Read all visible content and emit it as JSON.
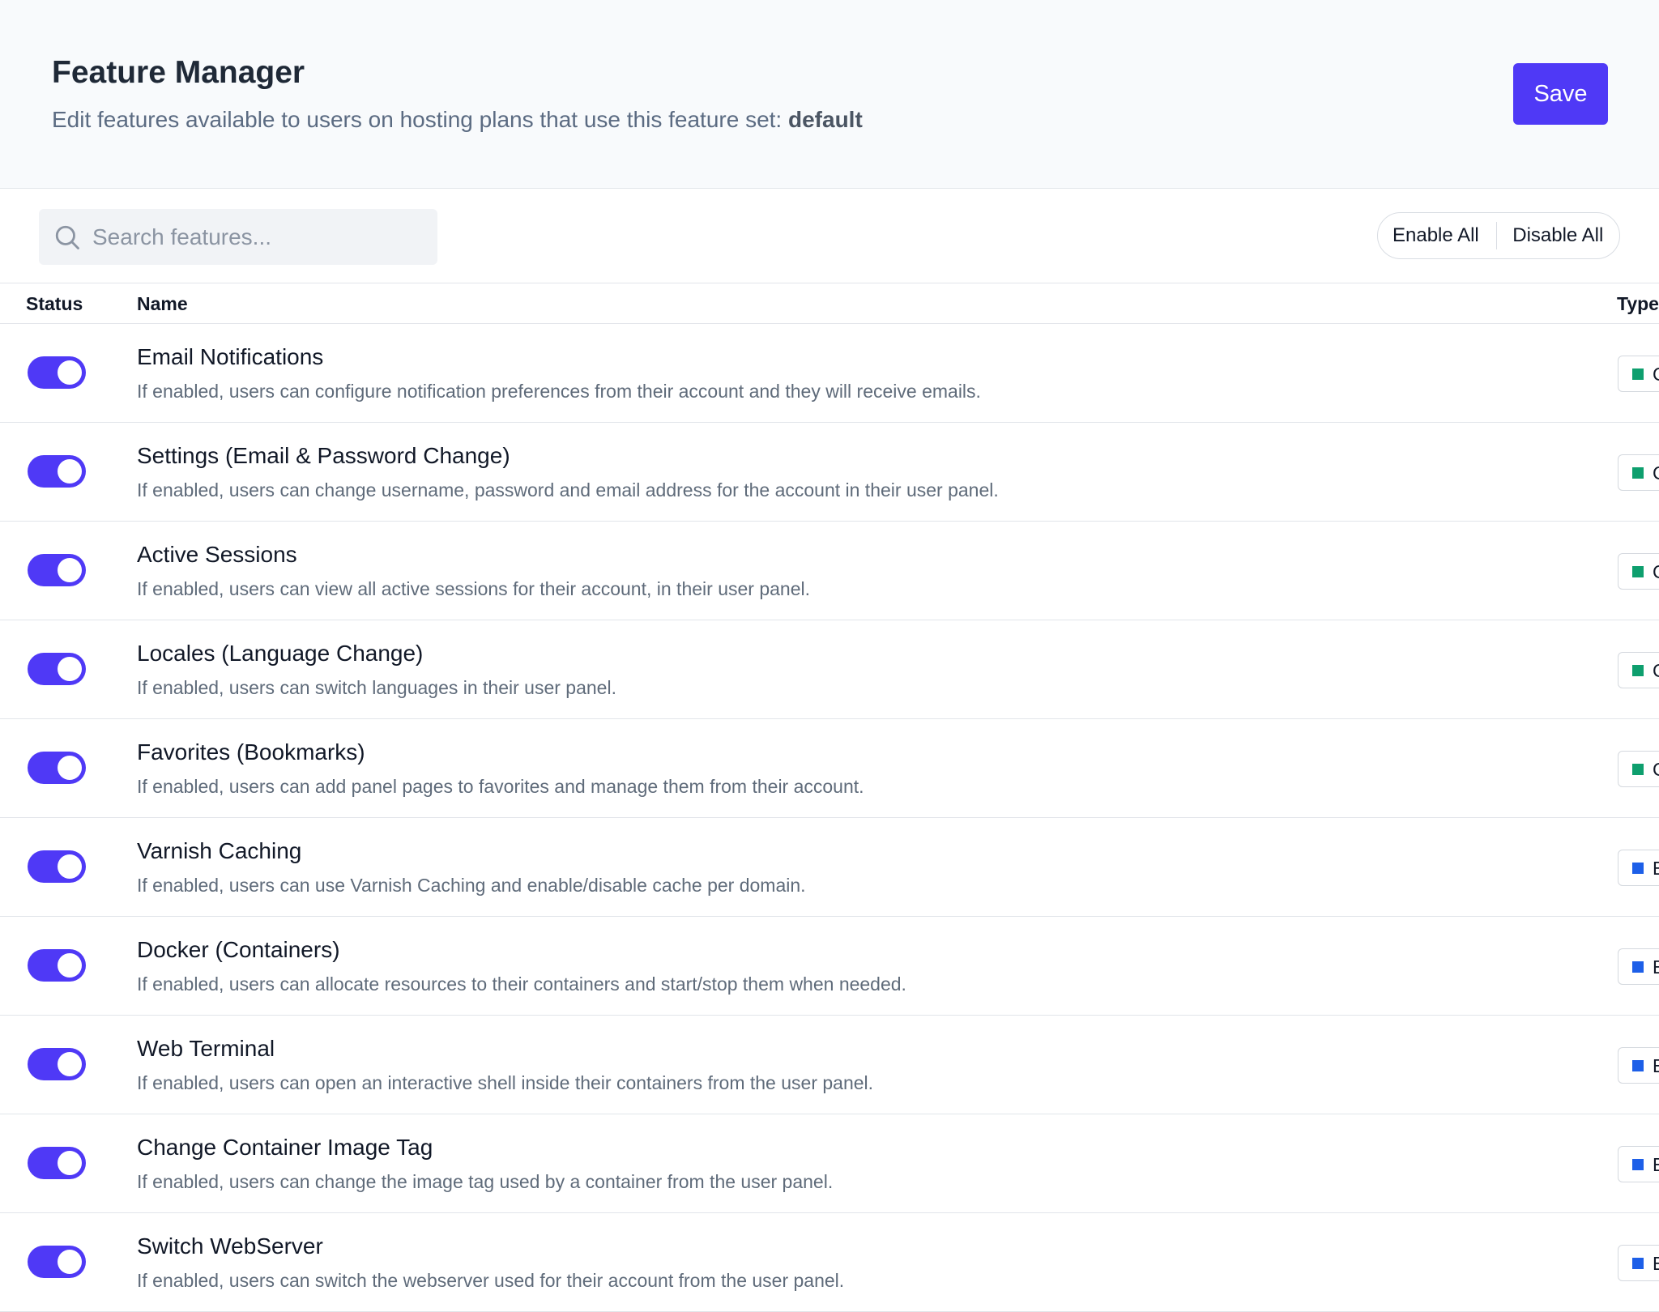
{
  "header": {
    "title": "Feature Manager",
    "subtitle_prefix": "Edit features available to users on hosting plans that use this feature set: ",
    "feature_set": "default",
    "save_label": "Save"
  },
  "toolbar": {
    "search_placeholder": "Search features...",
    "enable_all_label": "Enable All",
    "disable_all_label": "Disable All"
  },
  "table": {
    "columns": {
      "status": "Status",
      "name": "Name",
      "type": "Type"
    },
    "type_colors": {
      "green": "#0e9f6e",
      "blue": "#1d5fe8"
    },
    "rows": [
      {
        "name": "Email Notifications",
        "description": "If enabled, users can configure notification preferences from their account and they will receive emails.",
        "enabled": true,
        "type_letter": "C",
        "type_color": "#0e9f6e"
      },
      {
        "name": "Settings (Email & Password Change)",
        "description": "If enabled, users can change username, password and email address for the account in their user panel.",
        "enabled": true,
        "type_letter": "C",
        "type_color": "#0e9f6e"
      },
      {
        "name": "Active Sessions",
        "description": "If enabled, users can view all active sessions for their account, in their user panel.",
        "enabled": true,
        "type_letter": "C",
        "type_color": "#0e9f6e"
      },
      {
        "name": "Locales (Language Change)",
        "description": "If enabled, users can switch languages in their user panel.",
        "enabled": true,
        "type_letter": "C",
        "type_color": "#0e9f6e"
      },
      {
        "name": "Favorites (Bookmarks)",
        "description": "If enabled, users can add panel pages to favorites and manage them from their account.",
        "enabled": true,
        "type_letter": "C",
        "type_color": "#0e9f6e"
      },
      {
        "name": "Varnish Caching",
        "description": "If enabled, users can use Varnish Caching and enable/disable cache per domain.",
        "enabled": true,
        "type_letter": "E",
        "type_color": "#1d5fe8"
      },
      {
        "name": "Docker (Containers)",
        "description": "If enabled, users can allocate resources to their containers and start/stop them when needed.",
        "enabled": true,
        "type_letter": "E",
        "type_color": "#1d5fe8"
      },
      {
        "name": "Web Terminal",
        "description": "If enabled, users can open an interactive shell inside their containers from the user panel.",
        "enabled": true,
        "type_letter": "E",
        "type_color": "#1d5fe8"
      },
      {
        "name": "Change Container Image Tag",
        "description": "If enabled, users can change the image tag used by a container from the user panel.",
        "enabled": true,
        "type_letter": "E",
        "type_color": "#1d5fe8"
      },
      {
        "name": "Switch WebServer",
        "description": "If enabled, users can switch the webserver used for their account from the user panel.",
        "enabled": true,
        "type_letter": "E",
        "type_color": "#1d5fe8"
      }
    ]
  }
}
